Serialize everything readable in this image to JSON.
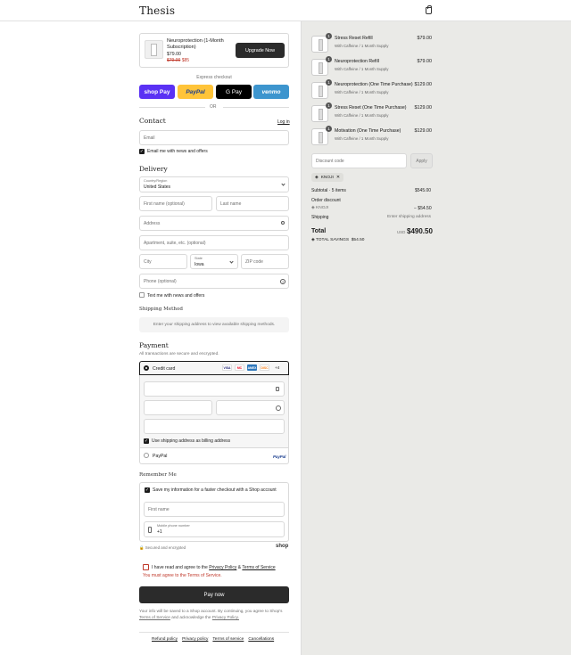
{
  "brand": {
    "name": "Thesis"
  },
  "upsell": {
    "title_line1": "Neuroprotection (1-Month",
    "title_line2": "Subscription)",
    "price": "$79.00",
    "original_price": "$79.00",
    "discount_price": "$85",
    "button": "Upgrade Now"
  },
  "express": {
    "label": "Express checkout",
    "or": "OR",
    "buttons": [
      "shop Pay",
      "PayPal",
      "G Pay",
      "venmo"
    ]
  },
  "contact": {
    "title": "Contact",
    "login": "Log in",
    "email_placeholder": "Email",
    "news_label": "Email me with news and offers"
  },
  "delivery": {
    "title": "Delivery",
    "country_label": "Country/Region",
    "country_value": "United States",
    "first_name": "First name (optional)",
    "last_name": "Last name",
    "address": "Address",
    "apartment": "Apartment, suite, etc. (optional)",
    "city": "City",
    "state_label": "State",
    "state_value": "Iowa",
    "zip": "ZIP code",
    "phone": "Phone (optional)",
    "text_label": "Text me with news and offers"
  },
  "shipping": {
    "title": "Shipping Method",
    "note": "Enter your shipping address to view available shipping methods."
  },
  "payment": {
    "title": "Payment",
    "subtitle": "All transactions are secure and encrypted.",
    "credit_card": "Credit card",
    "card_brands": [
      "VISA",
      "MC",
      "AMEX",
      "DISC"
    ],
    "more_cards": "+4",
    "billing_label": "Use shipping address as billing address",
    "paypal": "PayPal",
    "paypal_logo": "PayPal"
  },
  "remember": {
    "title": "Remember Me",
    "save_label": "Save my information for a faster checkout with a Shop account",
    "first_name": "First name",
    "mobile_label": "Mobile phone number",
    "mobile_value": "+1",
    "secure": "Secured and encrypted",
    "shop": "shop"
  },
  "terms": {
    "prefix": "I have read and agree to the",
    "privacy": "Privacy Policy",
    "amp": "&",
    "tos": "Terms of Service",
    "error": "You must agree to the Terms of Service."
  },
  "pay_button": "Pay now",
  "fineprint": {
    "line1": "Your info will be saved to a Shop account. By continuing, you agree to Shop's",
    "tos": "Terms of Service",
    "mid": "and acknowledge the",
    "privacy": "Privacy Policy."
  },
  "footer": {
    "links": [
      "Refund policy",
      "Privacy policy",
      "Terms of service",
      "Cancellations"
    ]
  },
  "cart": {
    "items": [
      {
        "name": "Stress Reset Refill",
        "sub": "With Caffeine / 1 Month Supply",
        "price": "$79.00",
        "qty": "1"
      },
      {
        "name": "Neuroprotection Refill",
        "sub": "With Caffeine / 1 Month Supply",
        "price": "$79.00",
        "qty": "1"
      },
      {
        "name": "Neuroprotection (One Time Purchase)",
        "sub": "With Caffeine / 1 Month Supply",
        "price": "$129.00",
        "qty": "1"
      },
      {
        "name": "Stress Reset (One Time Purchase)",
        "sub": "With Caffeine / 1 Month Supply",
        "price": "$129.00",
        "qty": "1"
      },
      {
        "name": "Motivation (One Time Purchase)",
        "sub": "With Caffeine / 1 Month Supply",
        "price": "$129.00",
        "qty": "1"
      }
    ],
    "discount_placeholder": "Discount code",
    "apply": "Apply",
    "code_tag": "KNOJI",
    "subtotal_label": "Subtotal · 5 items",
    "subtotal_value": "$545.00",
    "order_discount_label": "Order discount",
    "discount_code": "KNOJI",
    "discount_value": "− $54.50",
    "shipping_label": "Shipping",
    "shipping_value": "Enter shipping address",
    "total_label": "Total",
    "currency": "USD",
    "total_value": "$490.50",
    "savings_label": "TOTAL SAVINGS",
    "savings_value": "$54.50"
  }
}
